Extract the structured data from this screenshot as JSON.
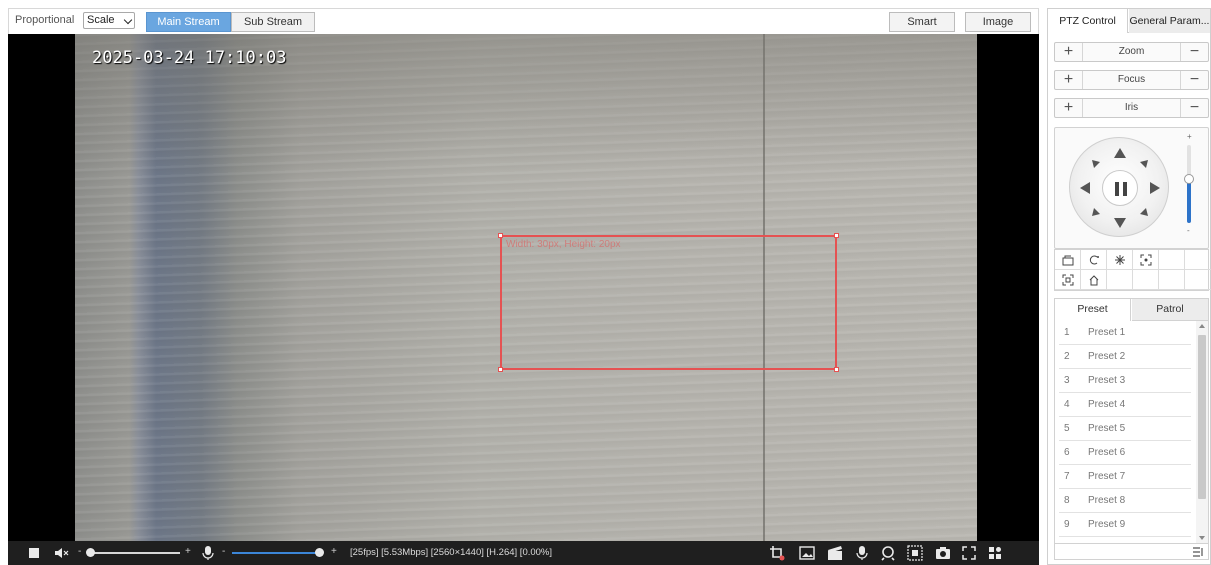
{
  "toolbar": {
    "display_mode_label": "Proportional",
    "scale_value": "Scale",
    "main_stream": "Main Stream",
    "sub_stream": "Sub Stream",
    "smart": "Smart",
    "image": "Image"
  },
  "video": {
    "timestamp": "2025-03-24 17:10:03",
    "roi_text": "Width: 30px, Height: 20px"
  },
  "statusbar": {
    "info": "[25fps] [5.53Mbps] [2560×1440] [H.264] [0.00%]",
    "volume_minus": "-",
    "volume_plus": "+",
    "mic_minus": "-",
    "mic_plus": "+",
    "volume_level": 0.0,
    "mic_level": 1.0
  },
  "panel": {
    "tabs": [
      "PTZ Control",
      "General Param..."
    ],
    "controls": [
      {
        "plus": "+",
        "label": "Zoom",
        "minus": "−"
      },
      {
        "plus": "+",
        "label": "Focus",
        "minus": "−"
      },
      {
        "plus": "+",
        "label": "Iris",
        "minus": "−"
      }
    ],
    "speed_plus": "+",
    "speed_minus": "-",
    "speed_level": 0.57,
    "preset_tabs": [
      "Preset",
      "Patrol"
    ],
    "presets": [
      {
        "num": "1",
        "name": "Preset 1"
      },
      {
        "num": "2",
        "name": "Preset 2"
      },
      {
        "num": "3",
        "name": "Preset 3"
      },
      {
        "num": "4",
        "name": "Preset 4"
      },
      {
        "num": "5",
        "name": "Preset 5"
      },
      {
        "num": "6",
        "name": "Preset 6"
      },
      {
        "num": "7",
        "name": "Preset 7"
      },
      {
        "num": "8",
        "name": "Preset 8"
      },
      {
        "num": "9",
        "name": "Preset 9"
      }
    ]
  },
  "colors": {
    "accent": "#6aa6e0",
    "roi": "#e55252",
    "statusbar": "#1f1f1f",
    "slider_fill": "#3c86d8"
  }
}
